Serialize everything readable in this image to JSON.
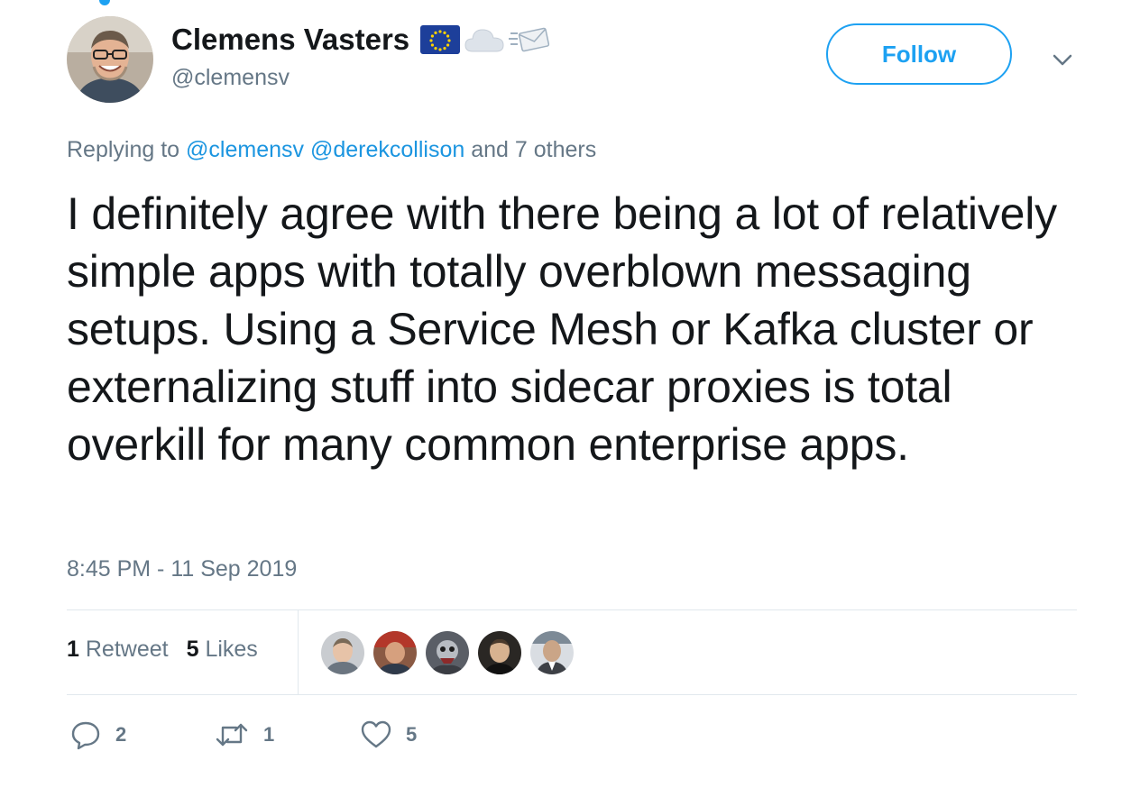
{
  "user": {
    "display_name": "Clemens Vasters",
    "handle": "@clemensv",
    "name_emojis": [
      "eu-flag-icon",
      "cloud-icon",
      "envelope-with-arrow-icon"
    ]
  },
  "follow_button": {
    "label": "Follow"
  },
  "reply_context": {
    "prefix": "Replying to",
    "mentions": [
      "@clemensv",
      "@derekcollison"
    ],
    "suffix": "and 7 others"
  },
  "tweet": {
    "text": "I definitely agree with there being a lot of relatively simple apps with totally overblown messaging setups. Using a Service Mesh or Kafka cluster or externalizing stuff into sidecar proxies is total overkill for many common enterprise apps.",
    "timestamp": "8:45 PM - 11 Sep 2019"
  },
  "stats": {
    "retweets_count": "1",
    "retweets_label": "Retweet",
    "likes_count": "5",
    "likes_label": "Likes"
  },
  "actions": {
    "replies": "2",
    "retweets": "1",
    "likes": "5"
  },
  "colors": {
    "accent": "#1da1f2",
    "mention": "#1b95e0",
    "muted": "#657786",
    "text": "#14171a",
    "divider": "#e1e8ed"
  }
}
